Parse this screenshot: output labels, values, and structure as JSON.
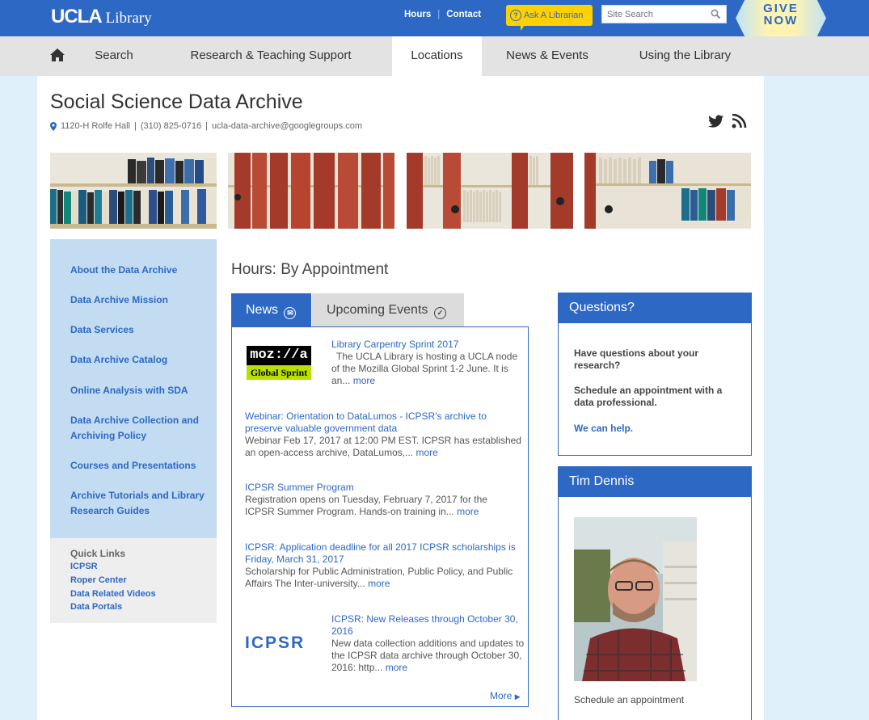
{
  "header": {
    "logo": "UCLA",
    "logo_suffix": "Library",
    "links": [
      "Hours",
      "Contact"
    ],
    "ask_label": "Ask A Librarian",
    "search_placeholder": "Site Search",
    "give_line1": "GIVE",
    "give_line2": "NOW",
    "accent": "#2d68c4",
    "ask_color": "#ffd100"
  },
  "nav": {
    "items": [
      "Search",
      "Research & Teaching Support",
      "Locations",
      "News & Events",
      "Using the Library"
    ],
    "active": "Locations"
  },
  "page": {
    "title": "Social Science Data Archive",
    "address": "1120-H Rolfe Hall",
    "phone": "(310) 825-0716",
    "email": "ucla-data-archive@googlegroups.com"
  },
  "sidebar": {
    "items": [
      "About the Data Archive",
      "Data Archive Mission",
      "Data Services",
      "Data Archive Catalog",
      "Online Analysis with SDA",
      "Data Archive Collection and Archiving Policy",
      "Courses and Presentations",
      "Archive Tutorials and Library Research Guides"
    ],
    "quick_title": "Quick Links",
    "quick_links": [
      "ICPSR",
      "Roper Center",
      "Data Related Videos",
      "Data Portals"
    ]
  },
  "main": {
    "hours": "Hours: By Appointment",
    "tabs": [
      "News",
      "Upcoming Events"
    ],
    "more_label": "more",
    "more_all": "More",
    "news": [
      {
        "title": "Library Carpentry Sprint 2017",
        "body": "The UCLA Library is hosting a UCLA node of the Mozilla Global Sprint 1-2 June. It is an..."
      },
      {
        "title": "Webinar: Orientation to DataLumos - ICPSR's archive to preserve valuable government data",
        "body": "Webinar Feb 17, 2017 at 12:00 PM EST. ICPSR has established an open-access archive, DataLumos,..."
      },
      {
        "title": "ICPSR Summer Program",
        "body": "Registration opens on Tuesday, February 7, 2017 for the ICPSR Summer Program. Hands-on training in..."
      },
      {
        "title": "ICPSR: Application deadline for all 2017 ICPSR scholarships is Friday, March 31, 2017",
        "body": "Scholarship for Public Administration, Public Policy, and Public Affairs The Inter-university..."
      },
      {
        "title": "ICPSR: New Releases through October 30, 2016",
        "body": "New data collection additions and updates to the ICPSR data archive through October 30, 2016: http..."
      }
    ],
    "moz_logo_line1": "moz://a",
    "moz_logo_line2": "Global Sprint",
    "icpsr_logo": "ICPSR"
  },
  "questions": {
    "title": "Questions?",
    "line1": "Have questions about your research?",
    "line2": "Schedule an appointment with a data professional.",
    "link": "We can help."
  },
  "person": {
    "name": "Tim Dennis",
    "caption": "Schedule an appointment"
  }
}
